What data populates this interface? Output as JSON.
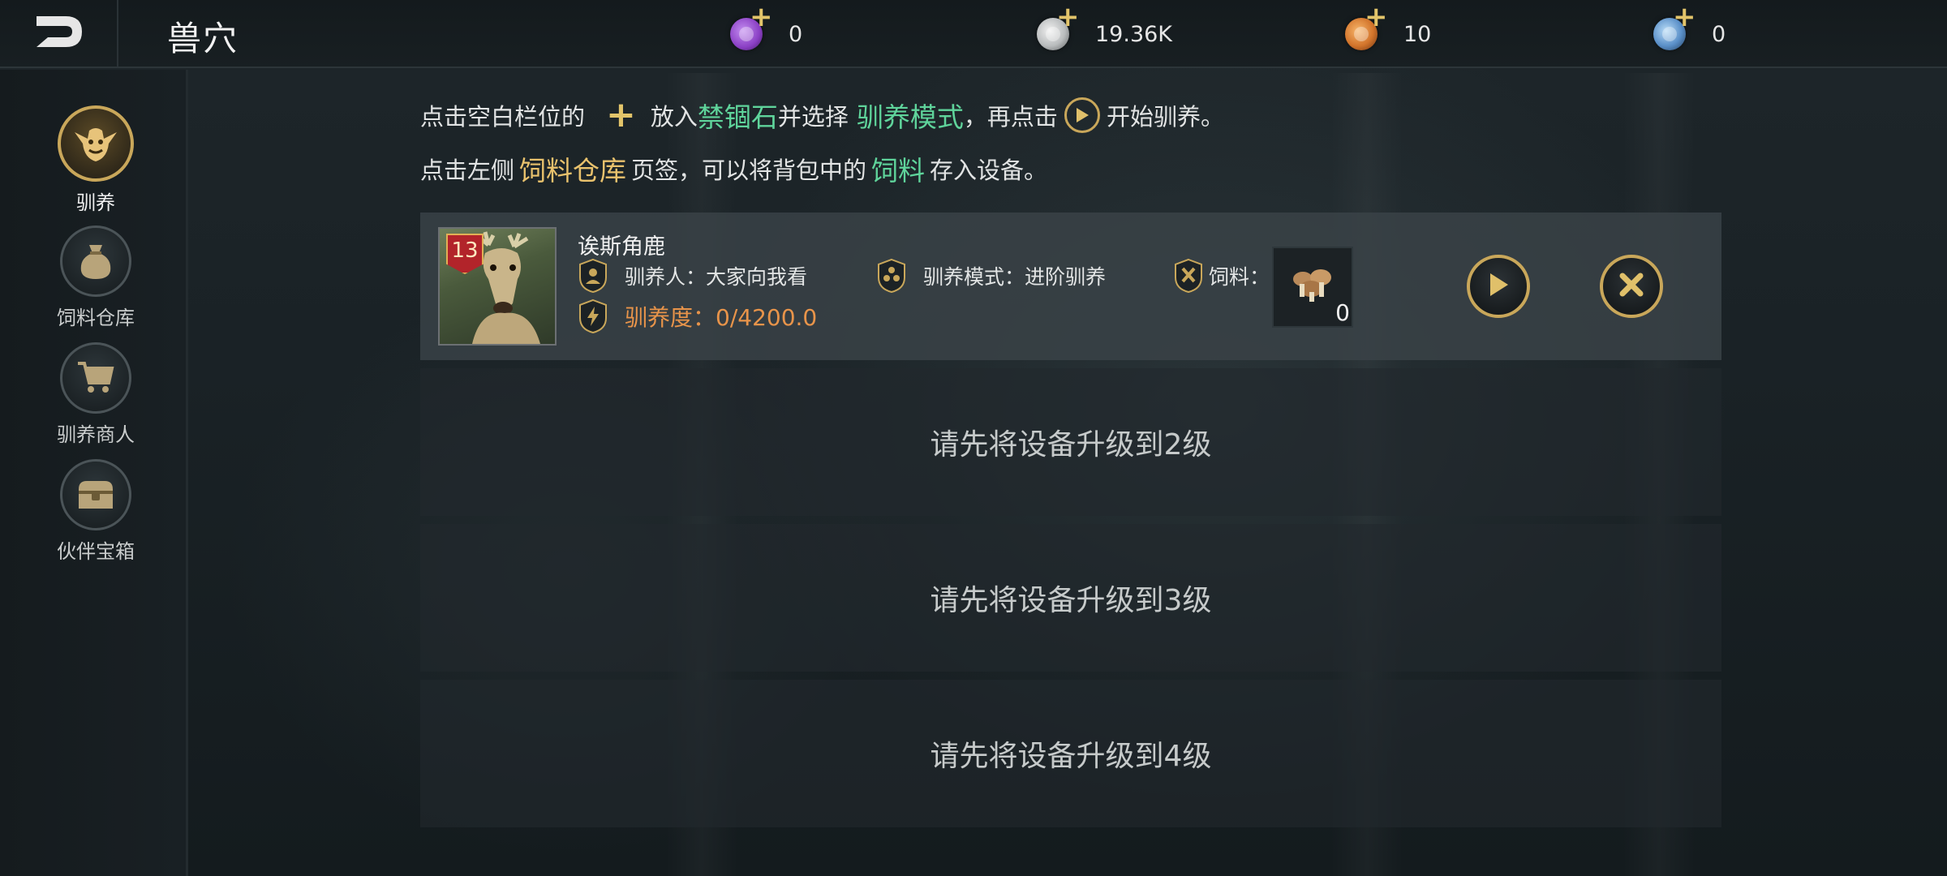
{
  "header": {
    "title": "兽穴",
    "back_icon": "back-arrow-icon"
  },
  "resources": [
    {
      "icon": "purple-gem-icon",
      "color": "#8a3fc4",
      "value": "0"
    },
    {
      "icon": "silver-coin-icon",
      "color": "#b9bcbd",
      "value": "19.36K"
    },
    {
      "icon": "orange-gem-icon",
      "color": "#d2742b",
      "value": "10"
    },
    {
      "icon": "blue-gem-icon",
      "color": "#5a8fc8",
      "value": "0"
    }
  ],
  "sidebar": {
    "items": [
      {
        "label": "驯养",
        "icon": "goblin-icon",
        "active": true
      },
      {
        "label": "饲料仓库",
        "icon": "sack-icon",
        "active": false
      },
      {
        "label": "驯养商人",
        "icon": "cart-icon",
        "active": false
      },
      {
        "label": "伙伴宝箱",
        "icon": "chest-icon",
        "active": false
      }
    ]
  },
  "instructions": {
    "line1": {
      "p1": "点击空白栏位的",
      "p2": "放入",
      "h1": "禁锢石",
      "p3": "并选择",
      "h2": "驯养模式",
      "p4": "，再点击",
      "p5": "开始驯养。"
    },
    "line2": {
      "p1": "点击左侧",
      "h1": "饲料仓库",
      "p2": "页签，可以将背包中的",
      "h2": "饲料",
      "p3": "存入设备。"
    }
  },
  "slot1": {
    "pet_name": "诶斯角鹿",
    "level": "13",
    "tamer": "驯养人：大家向我看",
    "mode": "驯养模式：进阶驯养",
    "food_label": "饲料：",
    "food_count": "0",
    "progress": "驯养度：0/4200.0",
    "progress_fraction": 0.0
  },
  "locked_slots": [
    {
      "text": "请先将设备升级到2级"
    },
    {
      "text": "请先将设备升级到3级"
    },
    {
      "text": "请先将设备升级到4级"
    }
  ],
  "colors": {
    "accent_gold": "#c9a75a",
    "highlight_green": "#5fd49b",
    "highlight_gold": "#e9c26d",
    "progress_orange": "#e8944a"
  }
}
